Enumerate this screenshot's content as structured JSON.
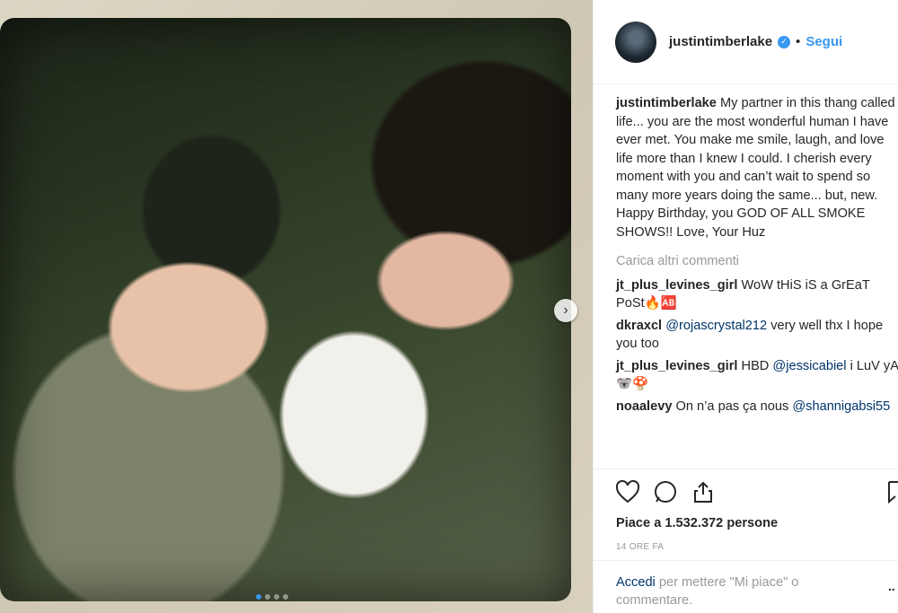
{
  "post": {
    "author": "justintimberlake",
    "follow_label": "Segui",
    "separator": "•",
    "caption": "My partner in this thang called life... you are the most wonderful human I have ever met. You make me smile, laugh, and love life more than I knew I could. I cherish every moment with you and can’t wait to spend so many more years doing the same... but, new. Happy Birthday, you GOD OF ALL SMOKE SHOWS!! Love, Your Huz",
    "load_more_label": "Carica altri commenti",
    "likes_text": "Piace a 1.532.372 persone",
    "timestamp": "14 ORE FA"
  },
  "comments": [
    {
      "author": "jt_plus_levines_girl",
      "text": "WoW tHiS iS a GrEaT PoSt🔥🆎"
    },
    {
      "author": "dkraxcl",
      "mention": "@rojascrystal212",
      "text": " very well thx I hope you too"
    },
    {
      "author": "jt_plus_levines_girl",
      "text_before": "HBD ",
      "mention": "@jessicabiel",
      "text": " i LuV yA 🐨🍄"
    },
    {
      "author": "noaalevy",
      "text": "On n’a pas ça nous ",
      "mention_after": "@shannigabsi55"
    }
  ],
  "login": {
    "link_label": "Accedi",
    "rest": " per mettere \"Mi piace\" o commentare."
  },
  "carousel": {
    "total_slides": 4,
    "active_index": 0
  },
  "colors": {
    "accent": "#3897f0",
    "link": "#003569",
    "muted": "#999999"
  },
  "icons": [
    "verified-badge-icon",
    "heart-icon",
    "comment-icon",
    "share-icon",
    "bookmark-icon",
    "chevron-right-icon",
    "more-icon"
  ]
}
